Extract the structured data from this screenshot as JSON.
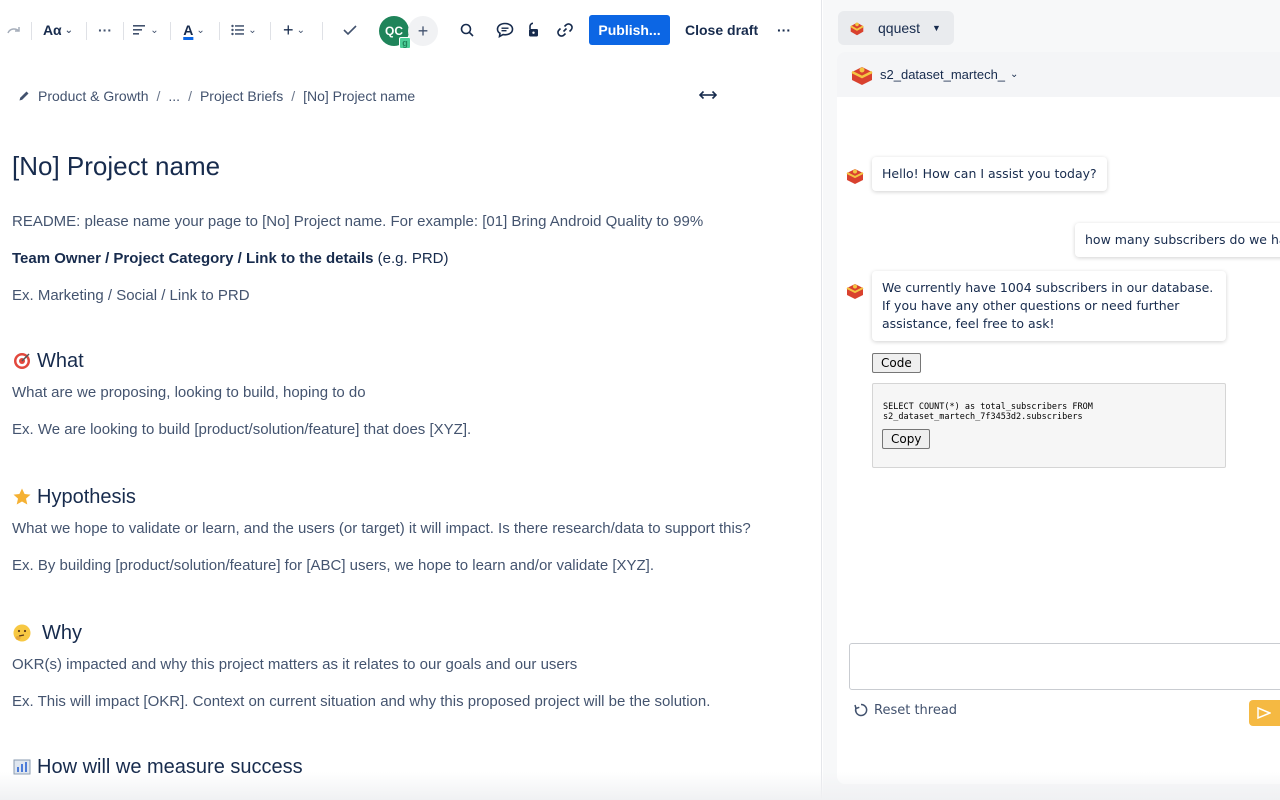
{
  "toolbar": {
    "text_style": "Aα",
    "more": "···",
    "avatar_initials": "QC",
    "avatar_badge": "g",
    "publish_label": "Publish...",
    "close_draft_label": "Close draft",
    "overflow": "···"
  },
  "breadcrumb": {
    "items": [
      "Product & Growth",
      "...",
      "Project Briefs",
      "[No] Project name"
    ],
    "separator": "/"
  },
  "doc": {
    "title": "[No] Project name",
    "readme": "README: please name your page to [No] Project name. For example: [01] Bring Android Quality to 99%",
    "owner_line": {
      "bold": "Team Owner / Project Category / Link to the details",
      "rest": " (e.g. PRD)"
    },
    "owner_example": "Ex. Marketing / Social / Link to PRD",
    "sections": [
      {
        "icon": "target-icon",
        "title": "What",
        "body": "What are we proposing, looking to build, hoping to do",
        "example": "Ex. We are looking to build [product/solution/feature] that does [XYZ]."
      },
      {
        "icon": "star-icon",
        "title": "Hypothesis",
        "body": "What we hope to validate or learn, and the users (or target) it will impact. Is there research/data to support this?",
        "example": "Ex. By building [product/solution/feature] for [ABC] users, we hope to learn and/or validate [XYZ]."
      },
      {
        "icon": "thinking-face-icon",
        "title": "Why",
        "body": "OKR(s) impacted and why this project matters as it relates to our goals and our users",
        "example": "Ex. This will impact [OKR]. Context on current situation and why this proposed project will be the solution."
      },
      {
        "icon": "chart-icon",
        "title": "How will we measure success",
        "body": "",
        "example": ""
      }
    ]
  },
  "panel": {
    "workspace": "qquest",
    "dataset": "s2_dataset_martech_",
    "messages": [
      {
        "role": "bot",
        "text": "Hello! How can I assist you today?"
      },
      {
        "role": "user",
        "text": "how many subscribers do we ha"
      },
      {
        "role": "bot",
        "text": "We currently have 1004 subscribers in our database. If you have any other questions or need further assistance, feel free to ask!"
      }
    ],
    "code_button": "Code",
    "code": "SELECT COUNT(*) as total_subscribers FROM\ns2_dataset_martech_7f3453d2.subscribers",
    "copy_button": "Copy",
    "input_value": "",
    "reset_label": "Reset thread"
  },
  "colors": {
    "publish": "#0c66e4",
    "avatar": "#1f845a",
    "send": "#f5b942"
  }
}
